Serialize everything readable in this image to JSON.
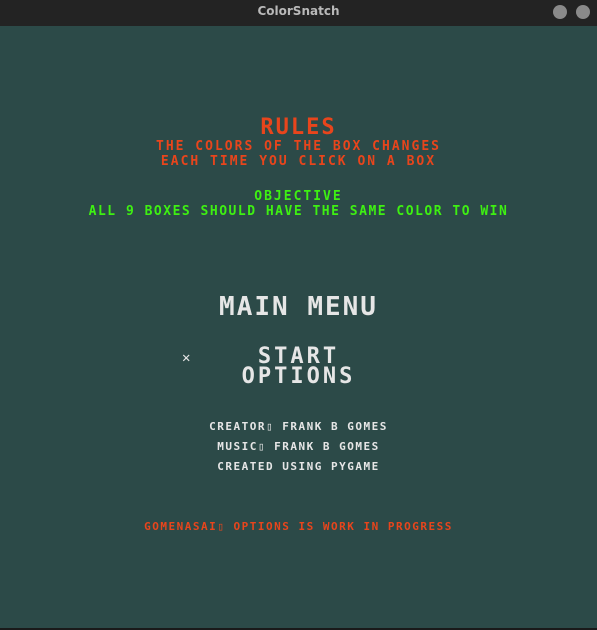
{
  "window": {
    "title": "ColorSnatch"
  },
  "rules": {
    "heading": "RULES",
    "line1": "THE COLORS OF THE BOX CHANGES",
    "line2": "EACH TIME YOU CLICK ON A BOX"
  },
  "objective": {
    "heading": "OBJECTIVE",
    "text": "ALL 9 BOXES SHOULD HAVE THE SAME COLOR TO WIN"
  },
  "menu": {
    "title": "MAIN MENU",
    "selector": "✕",
    "items": [
      {
        "label": "START"
      },
      {
        "label": "OPTIONS"
      }
    ]
  },
  "credits": {
    "creator": "CREATOR▯ FRANK B GOMES",
    "music": "MUSIC▯ FRANK B GOMES",
    "created_with": "CREATED USING PYGAME"
  },
  "notice": "GOMENASAI▯ OPTIONS IS WORK IN PROGRESS",
  "colors": {
    "background": "#2c4a48",
    "rules_text": "#e8451c",
    "objective_text": "#3ef012",
    "menu_text": "#e6e6e6"
  }
}
